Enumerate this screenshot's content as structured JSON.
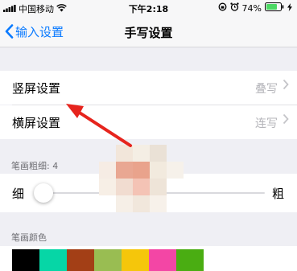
{
  "status_bar": {
    "carrier": "中国移动",
    "time": "下午2:18",
    "battery": "74%"
  },
  "nav": {
    "back_label": "输入设置",
    "title": "手写设置"
  },
  "settings": [
    {
      "label": "竖屏设置",
      "value": "叠写"
    },
    {
      "label": "横屏设置",
      "value": "连写"
    }
  ],
  "stroke_width": {
    "section_label": "笔画粗细: 4",
    "min_label": "细",
    "max_label": "粗",
    "level_fraction": 0.02
  },
  "stroke_color": {
    "section_label": "笔画颜色",
    "colors": [
      "#000000",
      "#06d6a6",
      "#a33f16",
      "#99bd52",
      "#f5c60b",
      "#f346a5",
      "#4aad12"
    ]
  },
  "colors": {
    "accent": "#0a7aff",
    "annotation_arrow": "#e6241d"
  }
}
